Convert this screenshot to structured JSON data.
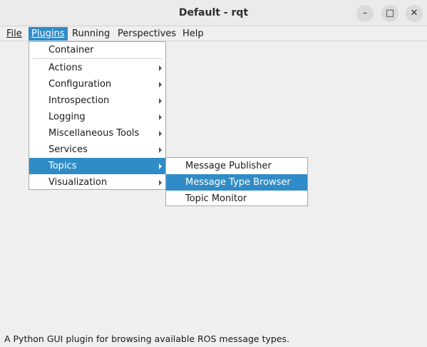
{
  "window": {
    "title": "Default - rqt",
    "minimize_icon": "minimize-icon",
    "maximize_icon": "maximize-icon",
    "close_icon": "close-icon"
  },
  "menubar": {
    "items": [
      {
        "label": "File",
        "active": false
      },
      {
        "label": "Plugins",
        "active": true
      },
      {
        "label": "Running",
        "active": false
      },
      {
        "label": "Perspectives",
        "active": false
      },
      {
        "label": "Help",
        "active": false
      }
    ]
  },
  "plugins_menu": {
    "items": [
      {
        "label": "Container",
        "submenu": false
      },
      {
        "label": "Actions",
        "submenu": true
      },
      {
        "label": "Configuration",
        "submenu": true
      },
      {
        "label": "Introspection",
        "submenu": true
      },
      {
        "label": "Logging",
        "submenu": true
      },
      {
        "label": "Miscellaneous Tools",
        "submenu": true
      },
      {
        "label": "Services",
        "submenu": true
      },
      {
        "label": "Topics",
        "submenu": true,
        "active": true
      },
      {
        "label": "Visualization",
        "submenu": true
      }
    ]
  },
  "topics_submenu": {
    "items": [
      {
        "label": "Message Publisher"
      },
      {
        "label": "Message Type Browser",
        "active": true
      },
      {
        "label": "Topic Monitor"
      }
    ]
  },
  "status": {
    "text": "A Python GUI plugin for browsing available ROS message types."
  },
  "colors": {
    "highlight": "#308cc6",
    "background": "#efefef"
  }
}
